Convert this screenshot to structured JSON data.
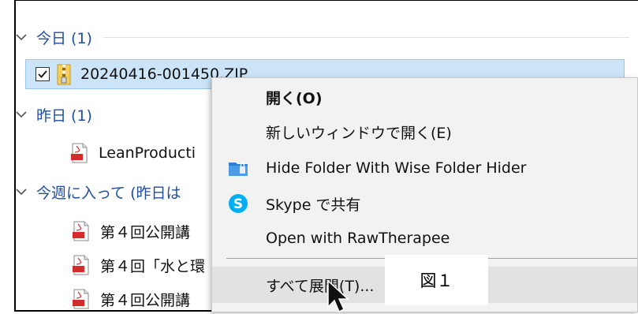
{
  "groups": {
    "today": {
      "label": "今日 (1)"
    },
    "yesterday": {
      "label": "昨日 (1)"
    },
    "this_week": {
      "label": "今週に入って (昨日は"
    }
  },
  "files": {
    "zip": {
      "name": "20240416-001450.ZIP"
    },
    "yesterday_pdf": {
      "name": "LeanProducti"
    },
    "week_pdfs": [
      {
        "name": "第４回公開講"
      },
      {
        "name": "第４回「水と環"
      },
      {
        "name": "第４回公開講"
      }
    ]
  },
  "context_menu": {
    "items": [
      {
        "label": "開く(O)"
      },
      {
        "label": "新しいウィンドウで開く(E)"
      },
      {
        "label": "Hide Folder With Wise Folder Hider",
        "icon": "wise-folder-hider-icon"
      },
      {
        "label": "Skype で共有",
        "icon": "skype-icon"
      },
      {
        "label": "Open with RawTherapee"
      },
      {
        "label": "すべて展開(T)..."
      }
    ]
  },
  "figure_label": "図１",
  "colors": {
    "group_header": "#1f4e9c",
    "selection_bg": "#cce4f7",
    "selection_border": "#99c9ef",
    "menu_bg": "#f2f2f2",
    "skype_blue": "#00aff0"
  }
}
